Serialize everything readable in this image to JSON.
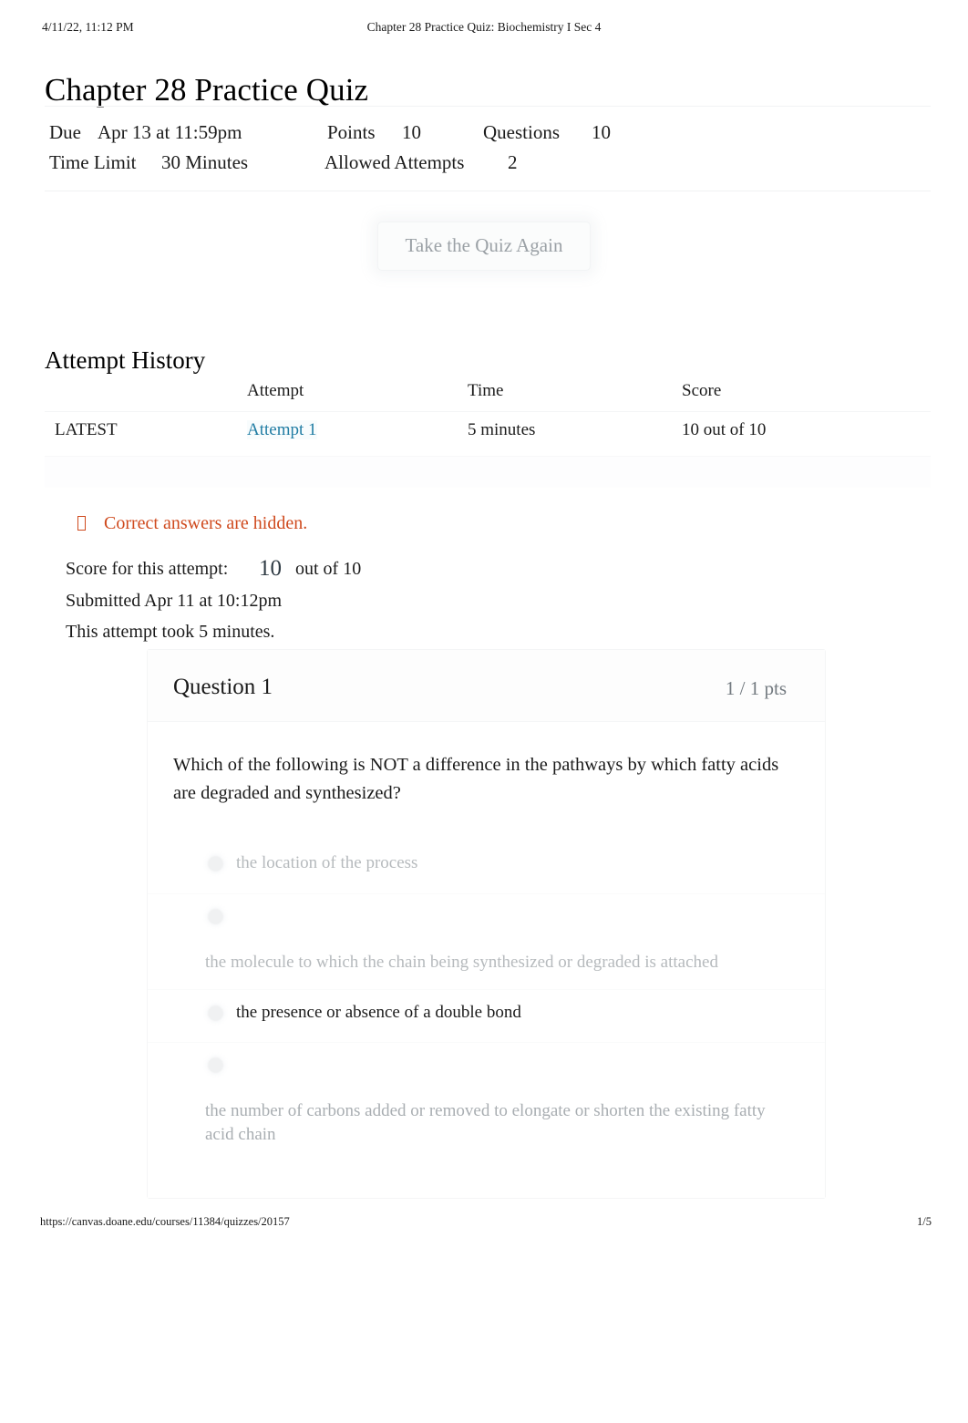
{
  "print": {
    "timestamp": "4/11/22, 11:12 PM",
    "doc_title": "Chapter 28 Practice Quiz: Biochemistry I Sec 4",
    "footer_url": "https://canvas.doane.edu/courses/11384/quizzes/20157",
    "page_number": "1/5"
  },
  "page_title": "Chapter 28 Practice Quiz",
  "quiz_meta": {
    "due_label": "Due",
    "due_value": "Apr 13 at 11:59pm",
    "points_label": "Points",
    "points_value": "10",
    "questions_label": "Questions",
    "questions_value": "10",
    "time_limit_label": "Time Limit",
    "time_limit_value": "30 Minutes",
    "allowed_attempts_label": "Allowed Attempts",
    "allowed_attempts_value": "2"
  },
  "take_again_label": "Take the Quiz Again",
  "attempt_history": {
    "heading": "Attempt History",
    "columns": [
      "",
      "Attempt",
      "Time",
      "Score"
    ],
    "rows": [
      {
        "latest": "LATEST",
        "attempt": "Attempt 1",
        "time": "5 minutes",
        "score": "10 out of 10"
      }
    ]
  },
  "hidden_notice": "Correct answers are hidden.",
  "attempt_summary": {
    "score_label": "Score for this attempt:",
    "score_value": "10",
    "score_outof": "out of 10",
    "submitted": "Submitted Apr 11 at 10:12pm",
    "duration": "This attempt took 5 minutes."
  },
  "question": {
    "name": "Question 1",
    "points": "1 / 1 pts",
    "text": "Which of the following is NOT a difference in the pathways by which fatty acids are degraded and synthesized?",
    "answers": [
      {
        "text": "the location of the process",
        "style": "inline",
        "tone": "dim"
      },
      {
        "text": "the molecule to which the chain being synthesized or degraded is attached",
        "style": "stacked",
        "tone": "dim"
      },
      {
        "text": "the presence or absence of a double bond",
        "style": "inline",
        "tone": "dark"
      },
      {
        "text": "the number of carbons added or removed to elongate or shorten the existing fatty acid chain",
        "style": "stacked",
        "tone": "dimmer"
      }
    ]
  },
  "colors": {
    "link": "#1f7ca3",
    "warning": "#cf4a1e",
    "text": "#1b1b1b",
    "muted": "#737a80"
  }
}
